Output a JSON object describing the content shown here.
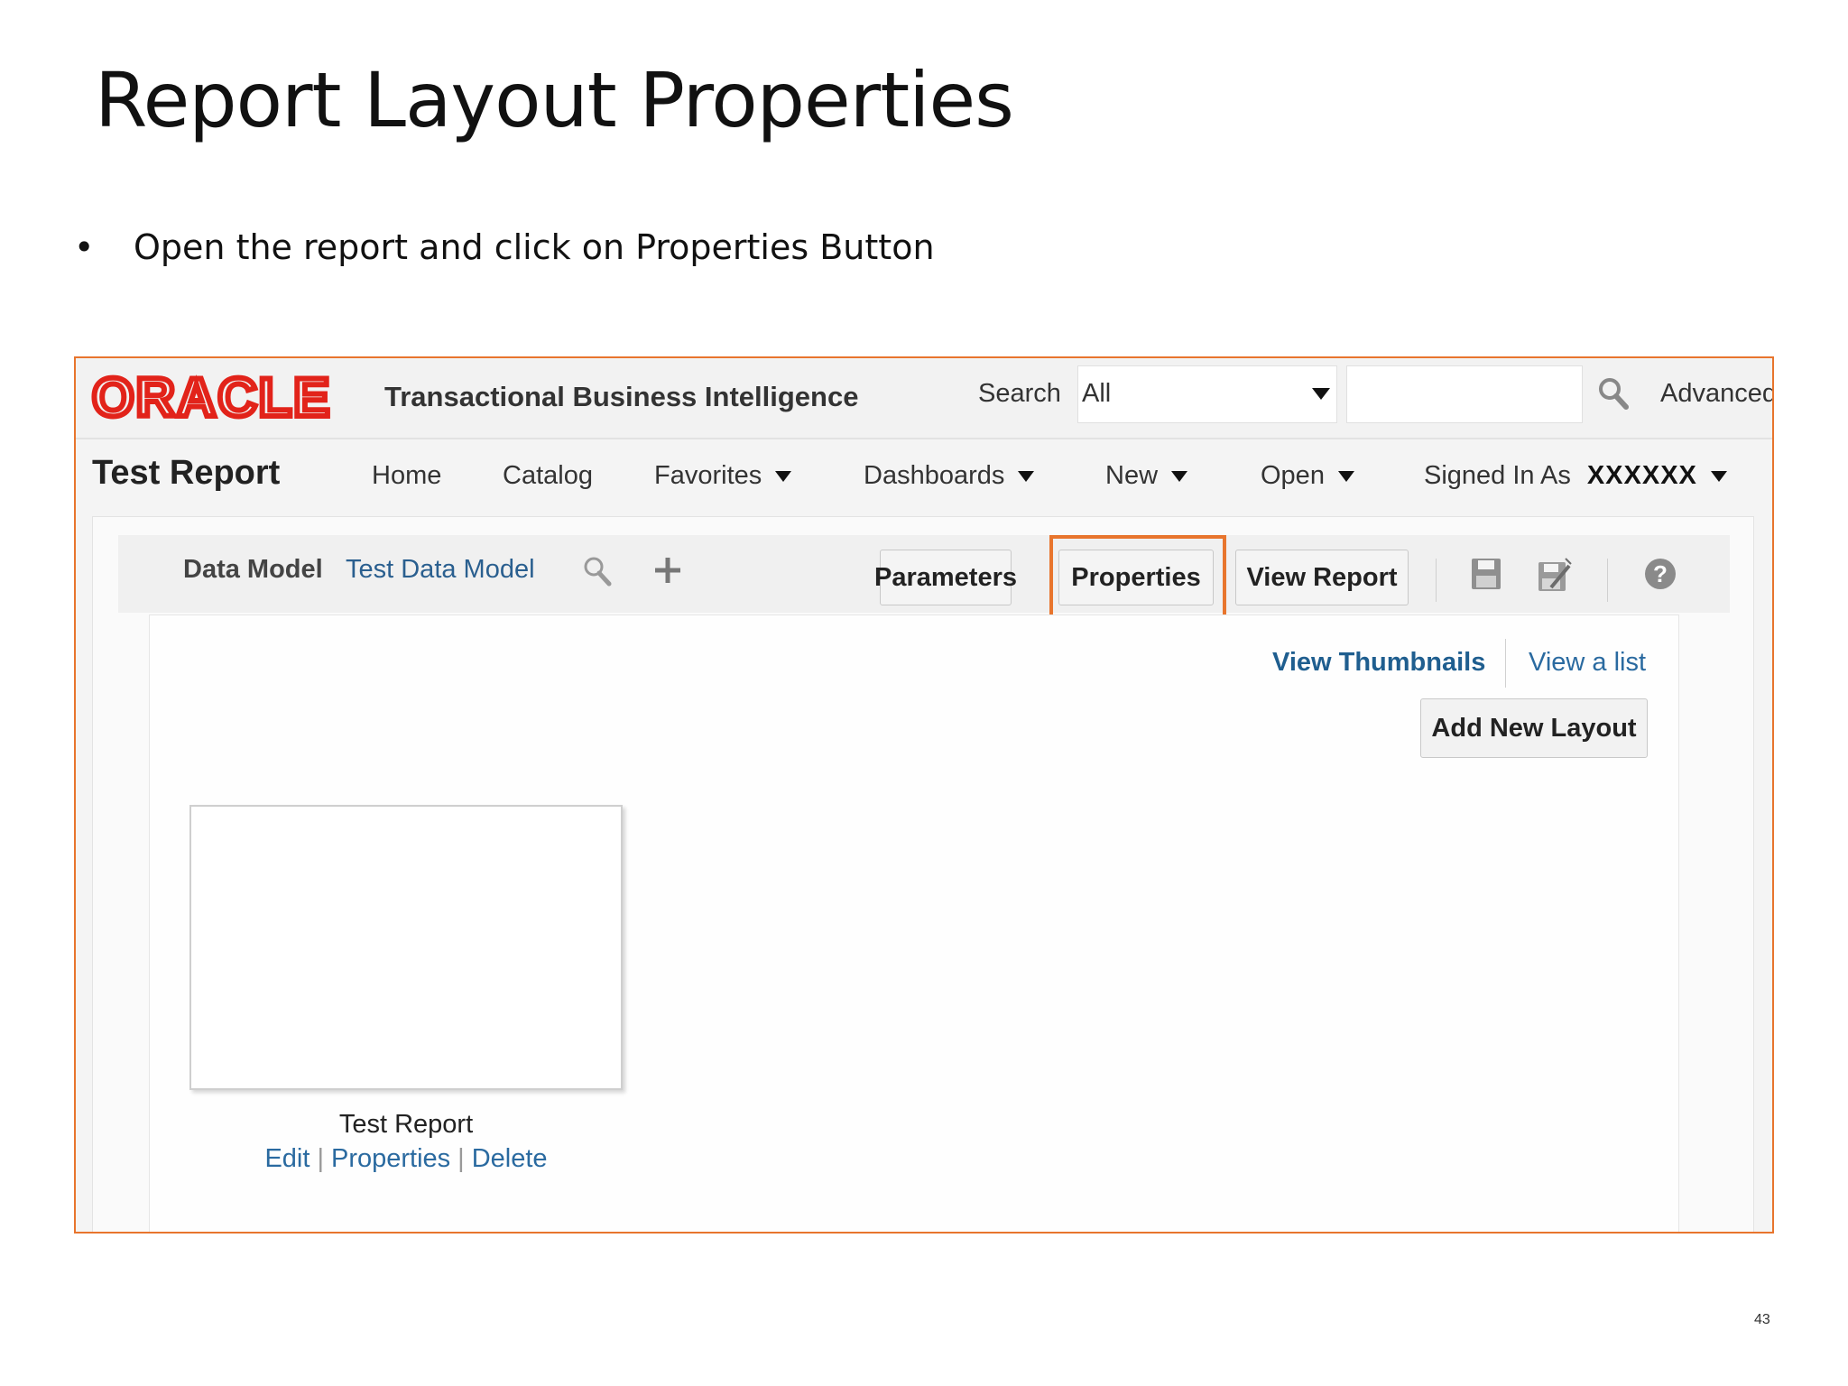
{
  "slide": {
    "title": "Report Layout Properties",
    "bullet": "Open the report and click on Properties Button",
    "page_number": "43"
  },
  "brand": {
    "logo_text": "ORACLE",
    "product": "Transactional Business Intelligence",
    "logo_color": "#e2231a"
  },
  "search": {
    "label": "Search",
    "scope": "All",
    "query": "",
    "advanced": "Advanced"
  },
  "nav": {
    "report_title": "Test Report",
    "home": "Home",
    "catalog": "Catalog",
    "favorites": "Favorites",
    "dashboards": "Dashboards",
    "new": "New",
    "open": "Open",
    "signed_in_label": "Signed In As",
    "signed_in_user": "XXXXXX"
  },
  "toolbar": {
    "data_model_label": "Data Model",
    "data_model_value": "Test Data Model",
    "parameters": "Parameters",
    "properties": "Properties",
    "view_report": "View Report",
    "highlight_color": "#e8752d"
  },
  "layouts": {
    "view_thumbnails": "View Thumbnails",
    "view_list": "View a list",
    "add_new_layout": "Add New Layout",
    "items": [
      {
        "name": "Test Report",
        "edit": "Edit",
        "properties": "Properties",
        "delete": "Delete"
      }
    ]
  }
}
